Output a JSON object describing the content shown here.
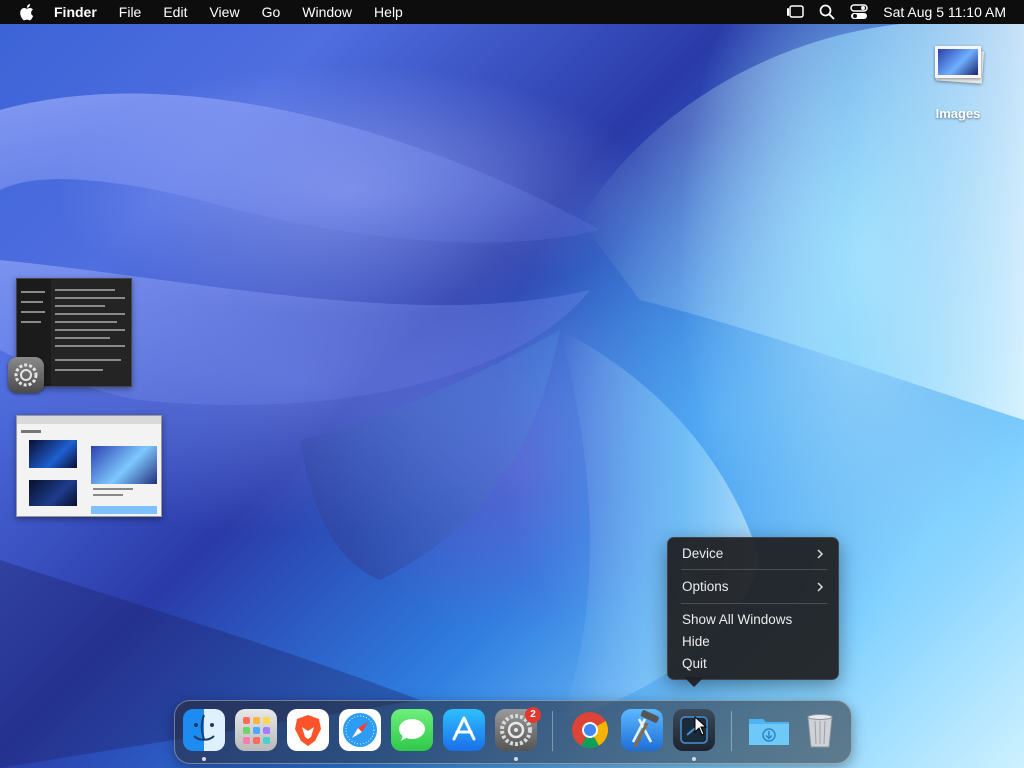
{
  "menubar": {
    "app_name": "Finder",
    "menus": [
      "File",
      "Edit",
      "View",
      "Go",
      "Window",
      "Help"
    ],
    "clock": "Sat Aug 5  11:10 AM"
  },
  "desktop": {
    "icons": [
      {
        "label": "Images"
      }
    ]
  },
  "context_menu": {
    "items": [
      "Device",
      "Options",
      "Show All Windows",
      "Hide",
      "Quit"
    ]
  },
  "dock": {
    "apps": [
      "Finder",
      "Launchpad",
      "Brave Browser",
      "Safari",
      "Messages",
      "App Store",
      "System Settings",
      "Google Chrome",
      "Xcode",
      "Simulator",
      "Downloads",
      "Trash"
    ],
    "settings_badge": "2"
  },
  "colors": {
    "menubar_bg": "#0d0d0d",
    "menu_bg": "#202022",
    "badge": "#e2382f"
  }
}
